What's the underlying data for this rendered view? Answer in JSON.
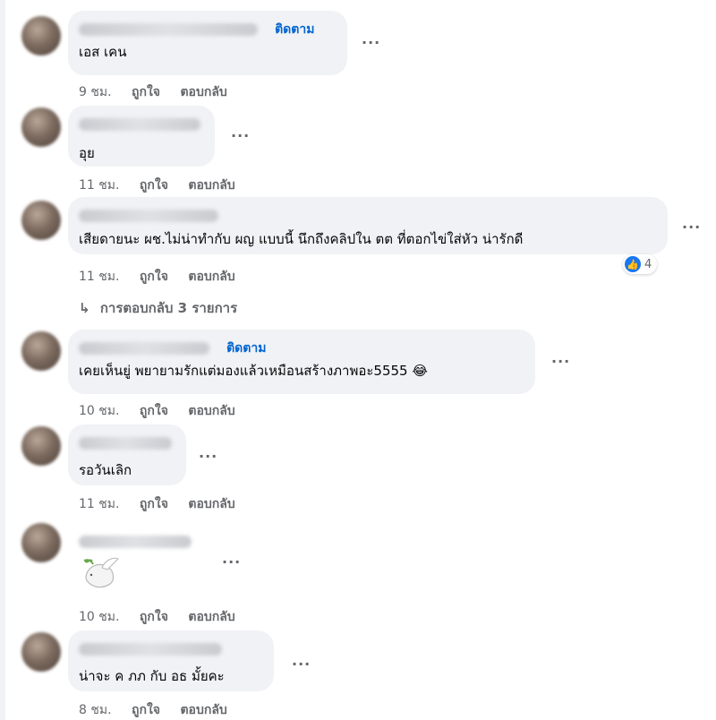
{
  "comments": [
    {
      "follow": "ติดตาม",
      "text": "เอส เคน",
      "time": "9 ชม.",
      "like": "ถูกใจ",
      "reply": "ตอบกลับ"
    },
    {
      "follow": "",
      "text": "อุย",
      "time": "11 ชม.",
      "like": "ถูกใจ",
      "reply": "ตอบกลับ"
    },
    {
      "follow": "",
      "text": "เสียดายนะ ผช.ไม่น่าทำกับ ผญ แบบนี้ นึกถึงคลิปใน ตต ที่ตอกไข่ใส่หัว น่ารักดี",
      "time": "11 ชม.",
      "like": "ถูกใจ",
      "reply": "ตอบกลับ",
      "reactions": "4",
      "replies": "การตอบกลับ 3 รายการ"
    },
    {
      "follow": "ติดตาม",
      "text": "เคยเห็นยู่ พยายามรักแต่มองแล้วเหมือนสร้างภาพอะ5555",
      "time": "10 ชม.",
      "like": "ถูกใจ",
      "reply": "ตอบกลับ"
    },
    {
      "follow": "",
      "text": "รอวันเลิก",
      "time": "11 ชม.",
      "like": "ถูกใจ",
      "reply": "ตอบกลับ"
    },
    {
      "follow": "",
      "text": "",
      "sticker": "dove-sticker",
      "time": "10 ชม.",
      "like": "ถูกใจ",
      "reply": "ตอบกลับ"
    },
    {
      "follow": "",
      "text": "น่าจะ ค ภภ กับ อธ มั้ยคะ",
      "time": "8 ชม.",
      "like": "ถูกใจ",
      "reply": "ตอบกลับ"
    }
  ],
  "more_glyph": "···",
  "reply_arrow": "↳",
  "colors": {
    "accent": "#0064d1",
    "bubble": "#f0f2f5",
    "muted": "#65676b",
    "like": "#1877f2"
  }
}
